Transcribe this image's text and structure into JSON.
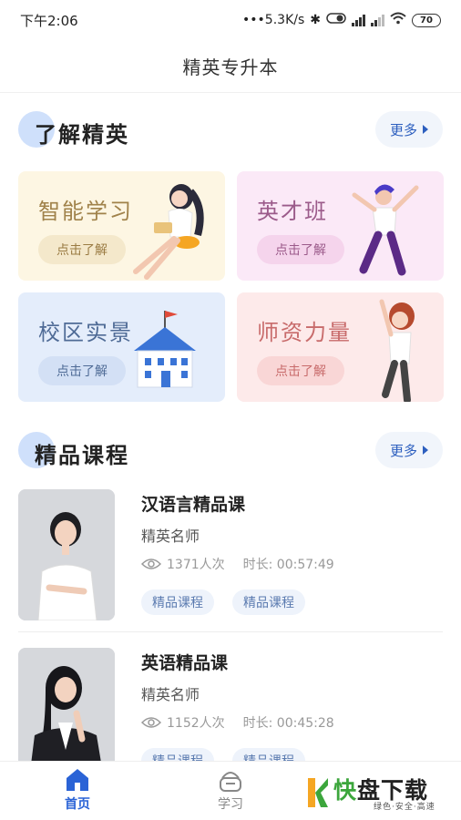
{
  "status_bar": {
    "time": "下午2:06",
    "net_speed": "•••5.3K/s",
    "battery": "70"
  },
  "nav": {
    "title": "精英专升本"
  },
  "section_about": {
    "title": "了解精英",
    "more_label": "更多"
  },
  "feature_cards": [
    {
      "title": "智能学习",
      "button": "点击了解"
    },
    {
      "title": "英才班",
      "button": "点击了解"
    },
    {
      "title": "校区实景",
      "button": "点击了解"
    },
    {
      "title": "师资力量",
      "button": "点击了解"
    }
  ],
  "section_courses": {
    "title": "精品课程",
    "more_label": "更多"
  },
  "courses": [
    {
      "title": "汉语言精品课",
      "teacher": "精英名师",
      "views": "1371人次",
      "duration": "时长: 00:57:49",
      "tags": [
        "精品课程",
        "精品课程"
      ]
    },
    {
      "title": "英语精品课",
      "teacher": "精英名师",
      "views": "1152人次",
      "duration": "时长: 00:45:28",
      "tags": [
        "精品课程",
        "精品课程"
      ]
    }
  ],
  "tab_bar": {
    "home": "首页",
    "study": "学习"
  },
  "watermark": {
    "main_green": "快",
    "main_rest": "盘下载",
    "sub": "绿色·安全·高速"
  },
  "colors": {
    "accent": "#2a63d6",
    "section_dot": "#cfe0fb"
  }
}
